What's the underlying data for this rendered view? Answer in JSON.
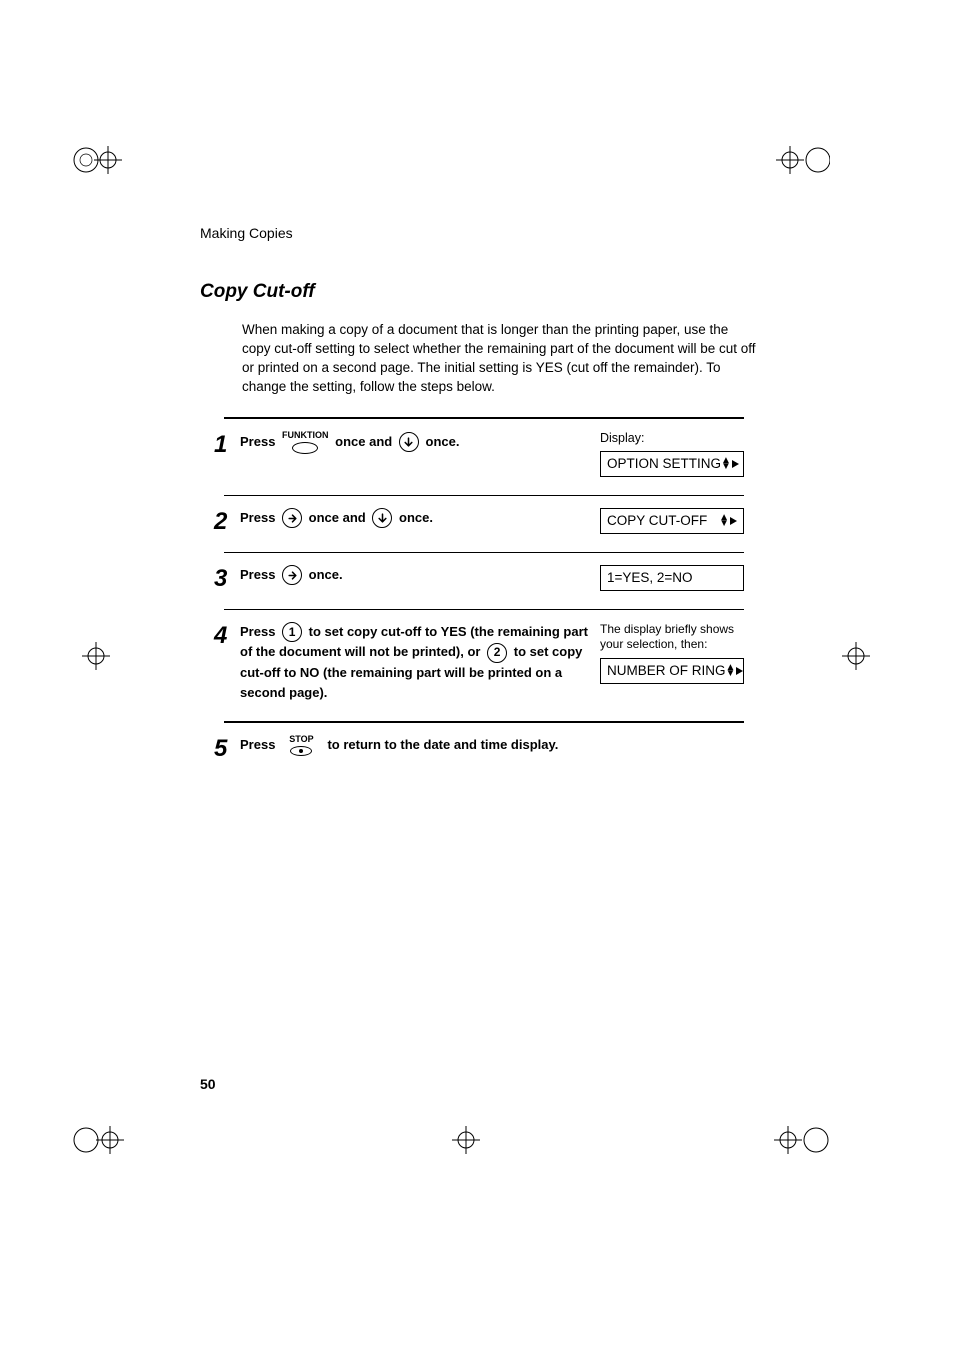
{
  "header": {
    "section": "Making Copies"
  },
  "title": "Copy Cut-off",
  "intro": "When making a copy of a document that is longer than the printing paper, use the copy cut-off setting to select whether the remaining part of the document will be cut off or printed on a second page. The initial setting is YES (cut off the remainder). To change the setting, follow the steps below.",
  "labels": {
    "press": "Press",
    "once_and": "once and",
    "once": "once.",
    "display": "Display:",
    "funktion": "FUNKTION",
    "stop": "STOP",
    "to_return": "to return to the date and time display."
  },
  "steps": {
    "s1": {
      "num": "1",
      "display": "OPTION SETTING"
    },
    "s2": {
      "num": "2",
      "display": "COPY CUT-OFF"
    },
    "s3": {
      "num": "3",
      "display": "1=YES, 2=NO"
    },
    "s4": {
      "num": "4",
      "t1": "to set copy cut-off to YES (the remaining part of the document will not be printed), or",
      "t2": "to set copy cut-off to NO (the remaining part will be printed on a second page).",
      "key1": "1",
      "key2": "2",
      "note": "The display briefly shows your selection, then:",
      "display": "NUMBER OF RING"
    },
    "s5": {
      "num": "5"
    }
  },
  "page_number": "50"
}
